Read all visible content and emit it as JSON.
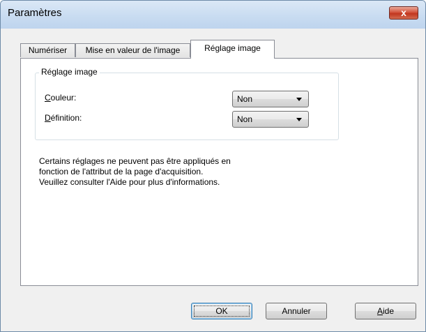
{
  "window": {
    "title": "Paramètres",
    "close_glyph": "x"
  },
  "tabs": [
    {
      "label": "Numériser"
    },
    {
      "label": "Mise en valeur de l'image"
    },
    {
      "label": "Réglage image",
      "active": true
    }
  ],
  "group": {
    "title": "Réglage image",
    "fields": [
      {
        "label_mnemonic": "C",
        "label_rest": "ouleur:",
        "value": "Non"
      },
      {
        "label_mnemonic": "D",
        "label_rest": "éfinition:",
        "value": "Non"
      }
    ]
  },
  "info_lines": [
    "Certains réglages ne peuvent pas être appliqués en",
    "fonction de l'attribut de la page d'acquisition.",
    "Veuillez consulter l'Aide pour plus d'informations."
  ],
  "buttons": {
    "ok": {
      "label": "OK"
    },
    "cancel": {
      "label": "Annuler"
    },
    "help": {
      "mnemonic": "A",
      "rest": "ide"
    }
  },
  "colors": {
    "titlebar": "#c9dcf1",
    "close_button": "#c1361f",
    "panel_bg": "#ffffff",
    "dialog_bg": "#f0f0f0"
  }
}
